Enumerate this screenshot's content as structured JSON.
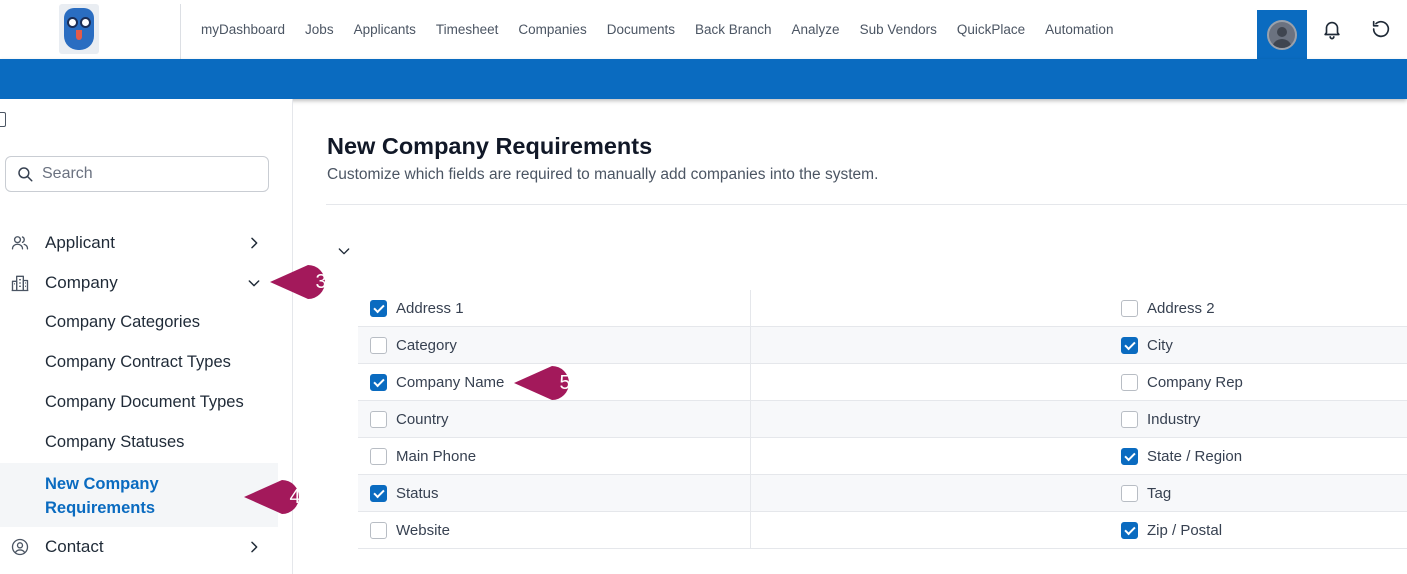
{
  "nav": {
    "items": [
      "myDashboard",
      "Jobs",
      "Applicants",
      "Timesheet",
      "Companies",
      "Documents",
      "Back Branch",
      "Analyze",
      "Sub Vendors",
      "QuickPlace",
      "Automation"
    ]
  },
  "sidebar": {
    "search_placeholder": "Search",
    "items": [
      {
        "label": "Applicant",
        "icon": "users-icon",
        "expanded": false
      },
      {
        "label": "Company",
        "icon": "building-icon",
        "expanded": true
      },
      {
        "label": "Contact",
        "icon": "user-circle-icon",
        "expanded": false
      }
    ],
    "company_sub_items": [
      "Company Categories",
      "Company Contract Types",
      "Company Document Types",
      "Company Statuses",
      "New Company Requirements"
    ],
    "active_sub_item": "New Company Requirements"
  },
  "main": {
    "title": "New Company Requirements",
    "subtitle": "Customize which fields are required to manually add companies into the system.",
    "fields": [
      {
        "left": {
          "label": "Address 1",
          "checked": true
        },
        "right": {
          "label": "Address 2",
          "checked": false
        }
      },
      {
        "left": {
          "label": "Category",
          "checked": false
        },
        "right": {
          "label": "City",
          "checked": true
        }
      },
      {
        "left": {
          "label": "Company Name",
          "checked": true
        },
        "right": {
          "label": "Company Rep",
          "checked": false
        }
      },
      {
        "left": {
          "label": "Country",
          "checked": false
        },
        "right": {
          "label": "Industry",
          "checked": false
        }
      },
      {
        "left": {
          "label": "Main Phone",
          "checked": false
        },
        "right": {
          "label": "State / Region",
          "checked": true
        }
      },
      {
        "left": {
          "label": "Status",
          "checked": true
        },
        "right": {
          "label": "Tag",
          "checked": false
        }
      },
      {
        "left": {
          "label": "Website",
          "checked": false
        },
        "right": {
          "label": "Zip / Postal",
          "checked": true
        }
      }
    ]
  },
  "callouts": [
    "3",
    "4",
    "5"
  ],
  "colors": {
    "accent": "#0a6bc0",
    "callout": "#a3195b"
  }
}
